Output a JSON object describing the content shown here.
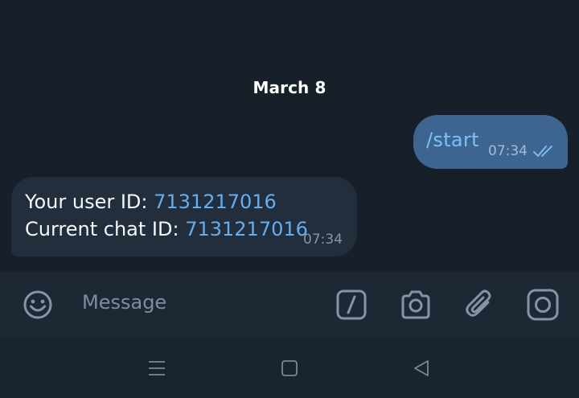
{
  "chat": {
    "date_separator": "March 8",
    "outgoing": {
      "text": "/start",
      "time": "07:34",
      "status_icon": "double-check-icon"
    },
    "incoming": {
      "line1_label": "Your user ID: ",
      "line1_value": "7131217016",
      "line2_label": "Current chat ID: ",
      "line2_value": "7131217016",
      "time": "07:34"
    }
  },
  "composer": {
    "placeholder": "Message",
    "icons": [
      "emoji-icon",
      "bot-command-icon",
      "camera-icon",
      "attach-icon",
      "instagram-icon"
    ]
  },
  "navigation": {
    "icons": [
      "menu-icon",
      "home-icon",
      "back-icon"
    ]
  },
  "colors": {
    "background": "#171f29",
    "outgoing_bubble": "#3d6590",
    "incoming_bubble": "#232e3c",
    "link_blue": "#62aef0",
    "input_bar": "#1e2834",
    "nav_bar": "#1a2330"
  }
}
